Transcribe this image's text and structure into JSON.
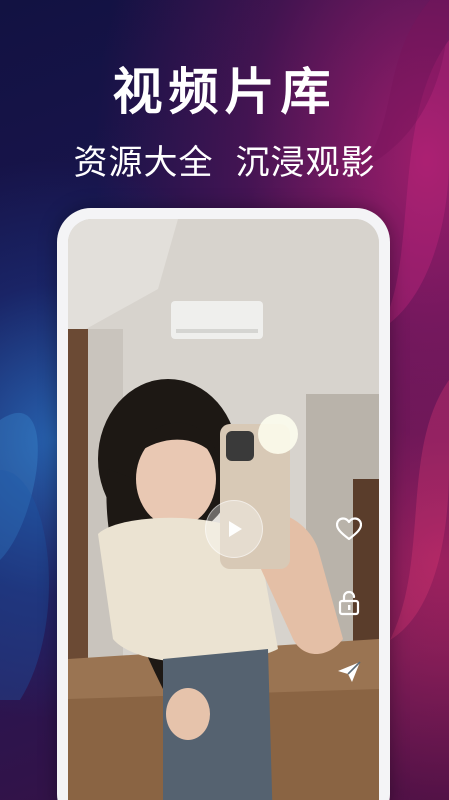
{
  "promo": {
    "headline": "视频片库",
    "subline_left": "资源大全",
    "subline_right": "沉浸观影"
  },
  "player": {
    "play_icon": "play-icon",
    "actions": [
      {
        "name": "like",
        "icon": "heart-icon"
      },
      {
        "name": "lock",
        "icon": "lock-icon"
      },
      {
        "name": "share",
        "icon": "send-icon"
      }
    ]
  },
  "colors": {
    "background_dark": "#1c1550",
    "accent_blue": "#2c6ebe",
    "accent_magenta": "#aa1e6e",
    "frame": "#f4f4f6",
    "text": "#ffffff"
  }
}
